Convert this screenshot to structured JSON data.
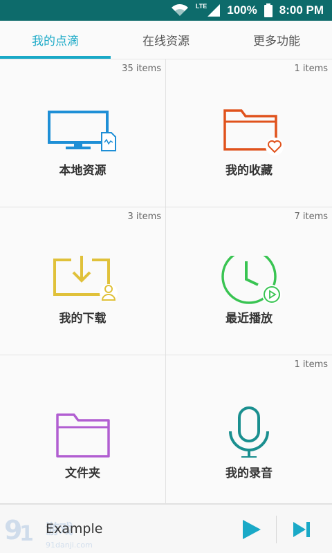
{
  "status_bar": {
    "network": "LTE",
    "battery_percent": "100%",
    "time": "8:00 PM"
  },
  "tabs": [
    {
      "label": "我的点滴",
      "active": true
    },
    {
      "label": "在线资源",
      "active": false
    },
    {
      "label": "更多功能",
      "active": false
    }
  ],
  "grid": [
    {
      "label": "本地资源",
      "count": "35 items",
      "icon": "monitor-file-icon",
      "color": "#1e8fd6"
    },
    {
      "label": "我的收藏",
      "count": "1 items",
      "icon": "folder-heart-icon",
      "color": "#e0521c"
    },
    {
      "label": "我的下载",
      "count": "3 items",
      "icon": "download-user-icon",
      "color": "#e0c13a"
    },
    {
      "label": "最近播放",
      "count": "7 items",
      "icon": "clock-play-icon",
      "color": "#39c452"
    },
    {
      "label": "文件夹",
      "count": "",
      "icon": "folder-icon",
      "color": "#b15ed1"
    },
    {
      "label": "我的录音",
      "count": "1 items",
      "icon": "microphone-icon",
      "color": "#1a8f8f"
    }
  ],
  "player": {
    "track_title": "Example",
    "watermark": "91游戏 91danji.com"
  },
  "colors": {
    "accent": "#1aa9c7",
    "status_bar": "#0d6b6b"
  }
}
